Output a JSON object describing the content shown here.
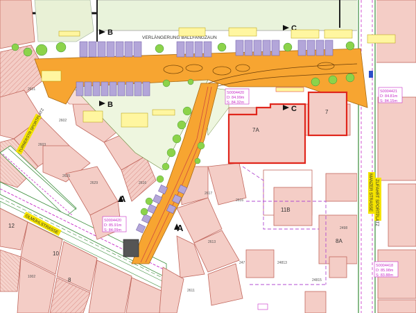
{
  "map": {
    "streets": {
      "top_band": "VERLÄNGERUNG BALLFANGZAUN",
      "left_diag": "TURNERSTR SPORTPLATZ",
      "muehl": "OLMÜHLSTRASSE",
      "right_name": "MANZER STRASSE",
      "right_zufahrt": "ZUFAHRT SPORTPLATZ"
    },
    "section_marks": {
      "b_top": "B",
      "b_mid": "B",
      "c_top": "C",
      "c_mid": "C",
      "a_left": "A",
      "a_right": "A"
    },
    "buildings": {
      "b7a": "7A",
      "b7": "7",
      "b11b": "11B",
      "b8a": "8A",
      "b10": "10",
      "b12": "12",
      "b8": "8"
    },
    "measurement_boxes": [
      {
        "id": "S0004420",
        "d": "D: 84.99m",
        "s": "S: 84.32m"
      },
      {
        "id": "S0004421",
        "d": "D: 84.81m",
        "s": "S: 84.15m"
      },
      {
        "id": "S0004420",
        "d": "D: 85.91m",
        "s": "S: 84.09m"
      },
      {
        "id": "S0004418",
        "d": "D: 85.98m",
        "s": "S: 83.88m"
      }
    ],
    "parcels": {
      "p2601": "2601",
      "p2602": "2602",
      "p2603": "2603",
      "p2625": "2625",
      "p2629": "2629",
      "p2616": "2616",
      "p2617": "2617",
      "p2616b": "2616",
      "p2613": "2613",
      "p2611": "2611",
      "p247": "247",
      "p24813": "24813",
      "p24815": "24815",
      "p2498": "2498",
      "p1002": "1002"
    },
    "colors": {
      "orange_surface": "#f7a531",
      "building_red": "#d04a3d",
      "purple_line": "#b04bd0",
      "green_area": "#8cd34a",
      "parcel_fill": "#f3c7bf",
      "yellow_label": "#f5e400",
      "red_outline": "#e0261c",
      "magenta_text": "#c72bc7"
    }
  }
}
